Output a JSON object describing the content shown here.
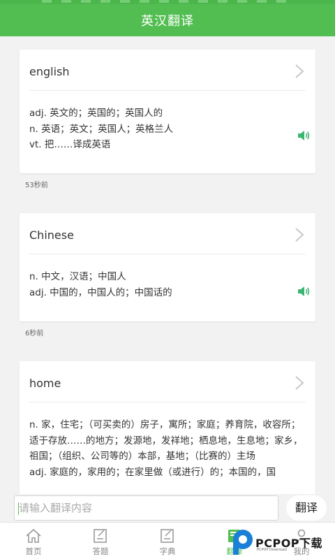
{
  "header": {
    "title": "英汉翻译"
  },
  "entries": [
    {
      "word": "english",
      "definitions": [
        "adj. 英文的；英国的；英国人的",
        "n. 英语；英文；英国人；英格兰人",
        "vt. 把……译成英语"
      ],
      "time": "53秒前"
    },
    {
      "word": "Chinese",
      "definitions": [
        "n. 中文，汉语；中国人",
        "adj. 中国的，中国人的；中国话的"
      ],
      "time": "6秒前"
    },
    {
      "word": "home",
      "definitions": [
        "n. 家，住宅；（可买卖的）房子，寓所；家庭；养育院，收容所；适于存放……的地方；发源地，发祥地；栖息地，生息地；家乡，祖国；（组织、公司等的）本部，基地；（比赛的）主场",
        "adj. 家庭的，家用的；在家里做（或进行）的；本国的，国"
      ]
    }
  ],
  "input": {
    "placeholder": "请输入翻译内容",
    "value": ""
  },
  "translate_button": "翻译",
  "tabs": [
    {
      "label": "首页",
      "icon": "home-icon"
    },
    {
      "label": "答题",
      "icon": "quiz-icon"
    },
    {
      "label": "字典",
      "icon": "dictionary-icon"
    },
    {
      "label": "翻译",
      "icon": "translate-icon",
      "active": true
    },
    {
      "label": "我的",
      "icon": "profile-icon"
    }
  ],
  "watermark": {
    "text": "PCPOP下载",
    "sub": "PCPOP Download"
  },
  "colors": {
    "accent": "#52be52",
    "speaker": "#3bb573"
  }
}
